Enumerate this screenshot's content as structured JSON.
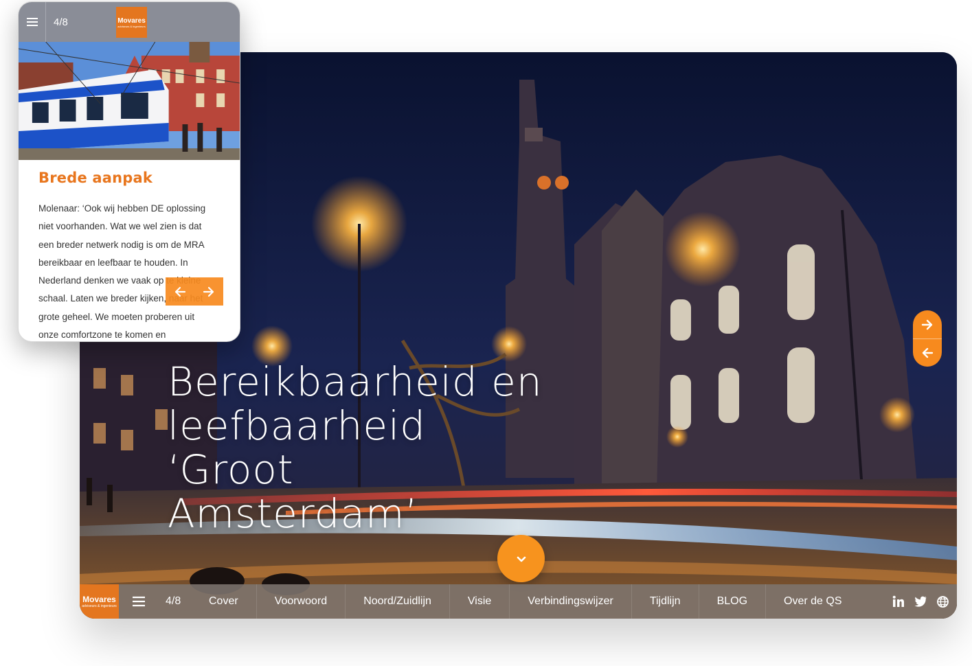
{
  "desktop": {
    "hero_title": "Bereikbaarheid en leefbaarheid ‘Groot Amsterdam’",
    "arrows": {
      "next_icon": "arrow-right-icon",
      "prev_icon": "arrow-left-icon"
    },
    "scroll_icon": "chevron-down-icon",
    "bottom_bar": {
      "logo_name": "Movares",
      "logo_sub": "adviseurs & ingenieurs",
      "page_count": "4/8",
      "nav_items": [
        "Cover",
        "Voorwoord",
        "Noord/Zuidlijn",
        "Visie",
        "Verbindingswijzer",
        "Tijdlijn",
        "BLOG",
        "Over de QS"
      ],
      "socials": [
        "linkedin-icon",
        "twitter-icon",
        "globe-icon"
      ]
    }
  },
  "mobile": {
    "page_count": "4/8",
    "logo_name": "Movares",
    "logo_sub": "adviseurs & ingenieurs",
    "heading": "Brede aanpak",
    "body_lines": [
      "Molenaar: ‘Ook wij hebben DE oplossing",
      "niet voorhanden. Wat we wel zien is dat",
      "een breder netwerk nodig is om de MRA",
      "bereikbaar en leefbaar te houden. In",
      "Nederland denken we vaak op te kleine",
      "schaal.  Laten we breder kijken, naar het",
      "grote geheel. We moeten proberen uit",
      "onze comfortzone te komen en"
    ]
  },
  "colors": {
    "accent": "#f7931e",
    "heading_orange": "#e8761e",
    "logo_orange": "#e4761f",
    "bar": "#7d746e"
  }
}
